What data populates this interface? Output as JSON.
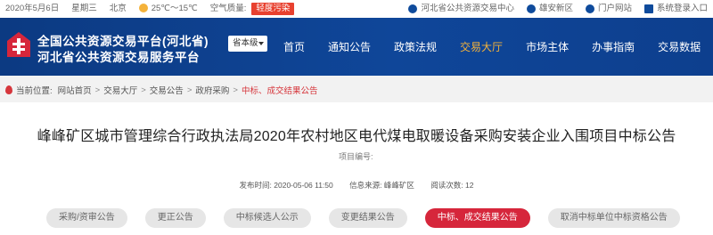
{
  "topbar": {
    "date": "2020年5月6日",
    "weekday": "星期三",
    "city": "北京",
    "temp": "25℃～15℃",
    "aqi_label": "空气质量:",
    "aqi_value": "轻度污染",
    "links": [
      {
        "label": "河北省公共资源交易中心",
        "icon": "home-icon"
      },
      {
        "label": "雄安新区",
        "icon": "location-icon"
      },
      {
        "label": "门户网站",
        "icon": "portal-icon"
      },
      {
        "label": "系统登录入口",
        "icon": "login-icon"
      }
    ]
  },
  "header": {
    "title_line1": "全国公共资源交易平台(河北省)",
    "title_line2": "河北省公共资源交易服务平台",
    "province_select": "省本级",
    "nav": [
      {
        "label": "首页",
        "active": false
      },
      {
        "label": "通知公告",
        "active": false
      },
      {
        "label": "政策法规",
        "active": false
      },
      {
        "label": "交易大厅",
        "active": true
      },
      {
        "label": "市场主体",
        "active": false
      },
      {
        "label": "办事指南",
        "active": false
      },
      {
        "label": "交易数据",
        "active": false
      }
    ],
    "colors": {
      "bg": "#0f4699",
      "active": "#f4b23a",
      "logo_red": "#d6263b"
    }
  },
  "breadcrumb": {
    "prefix": "当前位置:",
    "items": [
      "网站首页",
      "交易大厅",
      "交易公告",
      "政府采购"
    ],
    "current": "中标、成交结果公告"
  },
  "article": {
    "title": "峰峰矿区城市管理综合行政执法局2020年农村地区电代煤电取暖设备采购安装企业入围项目中标公告",
    "project_no_label": "项目编号:",
    "publish_label": "发布时间:",
    "publish_value": "2020-05-06 11:50",
    "source_label": "信息来源:",
    "source_value": "峰峰矿区",
    "views_label": "阅读次数:",
    "views_value": "12"
  },
  "tabs": [
    {
      "label": "采购/资审公告",
      "active": false
    },
    {
      "label": "更正公告",
      "active": false
    },
    {
      "label": "中标候选人公示",
      "active": false
    },
    {
      "label": "变更结果公告",
      "active": false
    },
    {
      "label": "中标、成交结果公告",
      "active": true
    },
    {
      "label": "取消中标单位中标资格公告",
      "active": false
    }
  ]
}
